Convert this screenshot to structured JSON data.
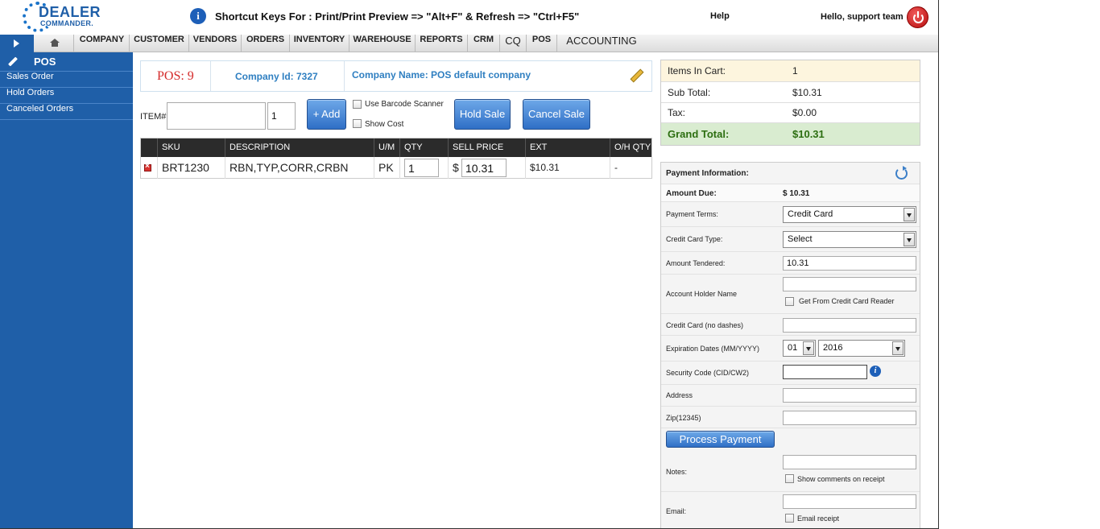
{
  "header": {
    "logo_line1": "DEALER",
    "logo_line2": "COMMANDER.",
    "shortcut_text": "Shortcut Keys For : Print/Print Preview => \"Alt+F\" & Refresh => \"Ctrl+F5\"",
    "help_label": "Help",
    "greeting": "Hello, support team"
  },
  "nav": {
    "items": [
      "COMPANY",
      "CUSTOMER",
      "VENDORS",
      "ORDERS",
      "INVENTORY",
      "WAREHOUSE",
      "REPORTS",
      "CRM",
      "CQ",
      "POS",
      "ACCOUNTING"
    ]
  },
  "sidebar": {
    "title": "POS",
    "items": [
      "Sales Order",
      "Hold Orders",
      "Canceled Orders"
    ]
  },
  "pos": {
    "pos_number": "POS: 9",
    "company_id": "Company Id: 7327",
    "company_name": "Company Name: POS default company"
  },
  "item_entry": {
    "label": "ITEM#",
    "item_value": "",
    "qty_value": "1",
    "add_label": "+ Add",
    "barcode_label": "Use Barcode Scanner",
    "show_cost_label": "Show Cost",
    "hold_label": "Hold Sale",
    "cancel_label": "Cancel Sale"
  },
  "table": {
    "headers": [
      "SKU",
      "DESCRIPTION",
      "U/M",
      "QTY",
      "SELL PRICE",
      "EXT",
      "O/H QTY"
    ],
    "rows": [
      {
        "sku": "BRT1230",
        "description": "RBN,TYP,CORR,CRBN",
        "um": "PK",
        "qty": "1",
        "currency": "$",
        "price": "10.31",
        "ext": "$10.31",
        "oh_qty": "-"
      }
    ]
  },
  "cart": {
    "items_label": "Items In Cart:",
    "items_value": "1",
    "subtotal_label": "Sub Total:",
    "subtotal_value": "$10.31",
    "tax_label": "Tax:",
    "tax_value": "$0.00",
    "grand_label": "Grand Total:",
    "grand_value": "$10.31"
  },
  "payment": {
    "title": "Payment Information:",
    "amount_due_label": "Amount Due:",
    "amount_due_value": "$ 10.31",
    "terms_label": "Payment Terms:",
    "terms_value": "Credit Card",
    "cc_type_label": "Credit Card Type:",
    "cc_type_value": "Select",
    "tendered_label": "Amount Tendered:",
    "tendered_value": "10.31",
    "holder_label": "Account Holder Name",
    "holder_value": "",
    "reader_label": "Get From Credit Card Reader",
    "cc_label": "Credit Card (no dashes)",
    "cc_value": "",
    "exp_label": "Expiration Dates (MM/YYYY)",
    "exp_month": "01",
    "exp_year": "2016",
    "cvv_label": "Security Code (CID/CW2)",
    "cvv_value": "",
    "address_label": "Address",
    "address_value": "",
    "zip_label": "Zip(12345)",
    "zip_value": "",
    "process_label": "Process Payment",
    "notes_label": "Notes:",
    "notes_value": "",
    "show_comments_label": "Show comments on receipt",
    "email_label": "Email:",
    "email_value": "",
    "email_receipt_label": "Email receipt"
  },
  "colors": {
    "brand_blue": "#1f5fa8",
    "accent_link": "#2f7fc1",
    "pos_red": "#d42a2a",
    "cart_items_bg": "#fdf5de",
    "grand_total_bg": "#d9ecd0",
    "grand_total_text": "#2c6e10"
  }
}
